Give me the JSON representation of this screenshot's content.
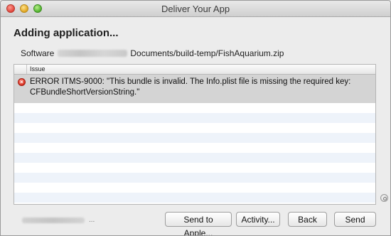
{
  "window": {
    "title": "Deliver Your App"
  },
  "heading": "Adding application...",
  "software": {
    "label": "Software",
    "path": "Documents/build-temp/FishAquarium.zip"
  },
  "table": {
    "column_header": "Issue",
    "rows": [
      {
        "type": "error",
        "icon": "error-icon",
        "text_line1": "ERROR ITMS-9000: \"This bundle is invalid. The Info.plist file is missing the required key:",
        "text_line2": "CFBundleShortVersionString.\""
      }
    ]
  },
  "footer": {
    "account_suffix": "..."
  },
  "buttons": {
    "send_to_apple": "Send to Apple...",
    "activity": "Activity...",
    "back": "Back",
    "send": "Send"
  },
  "colors": {
    "error": "#d42b1c",
    "selected_row": "#d4d4d4",
    "stripe": "#eef3fa"
  }
}
